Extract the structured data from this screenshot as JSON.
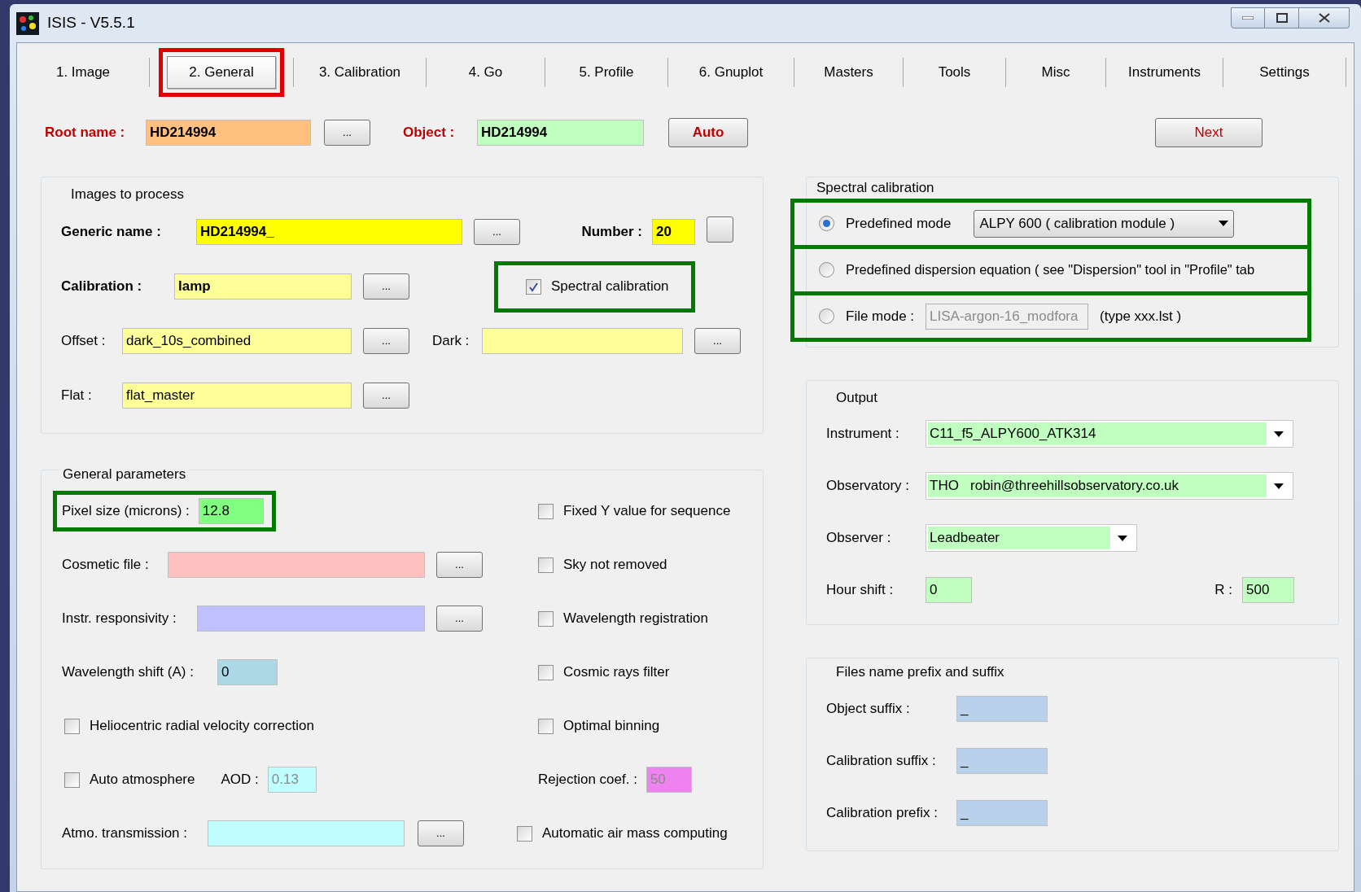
{
  "window": {
    "title": "ISIS - V5.5.1"
  },
  "tabs": [
    {
      "label": "1. Image",
      "selected": false
    },
    {
      "label": "2. General",
      "selected": true,
      "highlighted": true
    },
    {
      "label": "3. Calibration",
      "selected": false
    },
    {
      "label": "4. Go",
      "selected": false
    },
    {
      "label": "5. Profile",
      "selected": false
    },
    {
      "label": "6. Gnuplot",
      "selected": false
    },
    {
      "label": "Masters",
      "selected": false
    },
    {
      "label": "Tools",
      "selected": false
    },
    {
      "label": "Misc",
      "selected": false
    },
    {
      "label": "Instruments",
      "selected": false
    },
    {
      "label": "Settings",
      "selected": false
    }
  ],
  "header": {
    "root_name": {
      "label": "Root name :",
      "value": "HD214994",
      "color": "#ffc080",
      "button": {
        "kind": "browse",
        "label": "..."
      }
    },
    "object": {
      "label": "Object :",
      "value": "HD214994",
      "color": "#c0ffc0"
    },
    "auto_button": "Auto",
    "next_button": "Next"
  },
  "images_to_process": {
    "title": "Images to process",
    "generic_name": {
      "label": "Generic name :",
      "value": "HD214994_",
      "color": "#ffff00",
      "button": {
        "kind": "browse",
        "label": "..."
      }
    },
    "number": {
      "label": "Number :",
      "value": "20",
      "color": "#ffff00",
      "button": {
        "kind": "blank"
      }
    },
    "calibration": {
      "label": "Calibration :",
      "value": "lamp",
      "color": "#ffff99",
      "button": {
        "kind": "browse",
        "label": "..."
      }
    },
    "spectral_calibration": {
      "label": "Spectral calibration",
      "checked": true,
      "highlighted": true
    },
    "offset": {
      "label": "Offset :",
      "value": "dark_10s_combined",
      "color": "#ffff99",
      "button": {
        "kind": "browse",
        "label": "..."
      }
    },
    "dark": {
      "label": "Dark :",
      "color": "#ffff99",
      "button": {
        "kind": "browse",
        "label": "..."
      }
    },
    "flat": {
      "label": "Flat :",
      "value": "flat_master",
      "color": "#ffff99",
      "button": {
        "kind": "browse",
        "label": "..."
      }
    }
  },
  "general_parameters": {
    "title": "General parameters",
    "pixel_size": {
      "label": "Pixel size (microns) :",
      "value": "12.8",
      "color": "#80ff80",
      "highlighted": true
    },
    "cosmetic_file": {
      "label": "Cosmetic file :",
      "color": "#ffc0c0",
      "button": {
        "kind": "browse",
        "label": "..."
      }
    },
    "instr_responsivity": {
      "label": "Instr. responsivity :",
      "color": "#c0c0ff",
      "button": {
        "kind": "browse",
        "label": "..."
      }
    },
    "wavelength_shift": {
      "label": "Wavelength shift (A) :",
      "value": "0",
      "color": "#add8e6"
    },
    "heliocentric": {
      "label": "Heliocentric radial velocity correction",
      "checked": false
    },
    "auto_atmosphere": {
      "label": "Auto atmosphere",
      "checked": false
    },
    "aod": {
      "label": "AOD :",
      "value": "0.13",
      "color": "#c0ffff",
      "disabled": true
    },
    "atmo_transmission": {
      "label": "Atmo. transmission :",
      "color": "#c0ffff",
      "button": {
        "kind": "browse",
        "label": "..."
      }
    },
    "options": [
      {
        "label": "Fixed Y value for sequence",
        "checked": false
      },
      {
        "label": "Sky not removed",
        "checked": false
      },
      {
        "label": "Wavelength registration",
        "checked": false
      },
      {
        "label": "Cosmic rays filter",
        "checked": false
      },
      {
        "label": "Optimal binning",
        "checked": false
      }
    ],
    "rejection_coef": {
      "label": "Rejection coef. :",
      "value": "50",
      "color": "#ee82ee",
      "disabled": true
    },
    "air_mass": {
      "label": "Automatic air mass computing",
      "checked": false
    }
  },
  "spectral_calibration": {
    "title": "Spectral calibration",
    "modes": [
      {
        "kind": "dropdown",
        "label": "Predefined mode",
        "selected": true,
        "highlighted": true,
        "value": "ALPY 600 ( calibration module )"
      },
      {
        "kind": "plain",
        "label": "Predefined dispersion equation ( see \"Dispersion\" tool in \"Profile\" tab",
        "selected": false,
        "highlighted": true
      },
      {
        "kind": "file",
        "label": "File mode :",
        "selected": false,
        "highlighted": true,
        "value": "LISA-argon-16_modfora",
        "note": "(type xxx.lst )",
        "disabled": true
      }
    ]
  },
  "output": {
    "title": "Output",
    "instrument": {
      "label": "Instrument :",
      "value": "C11_f5_ALPY600_ATK314",
      "color": "#c0ffc0"
    },
    "observatory": {
      "label": "Observatory :",
      "value": "THO   robin@threehillsobservatory.co.uk",
      "color": "#c0ffc0"
    },
    "observer": {
      "label": "Observer :",
      "value": "Leadbeater",
      "color": "#c0ffc0"
    },
    "hour_shift": {
      "label": "Hour shift :",
      "value": "0",
      "color": "#c0ffc0"
    },
    "r": {
      "label": "R :",
      "value": "500",
      "color": "#c0ffc0"
    }
  },
  "files_name": {
    "title": "Files name prefix and suffix",
    "fields": [
      {
        "label": "Object suffix :",
        "value": "_",
        "color": "#b9d1ea"
      },
      {
        "label": "Calibration suffix :",
        "value": "_",
        "color": "#b9d1ea"
      },
      {
        "label": "Calibration prefix :",
        "value": "_",
        "color": "#b9d1ea"
      }
    ]
  }
}
